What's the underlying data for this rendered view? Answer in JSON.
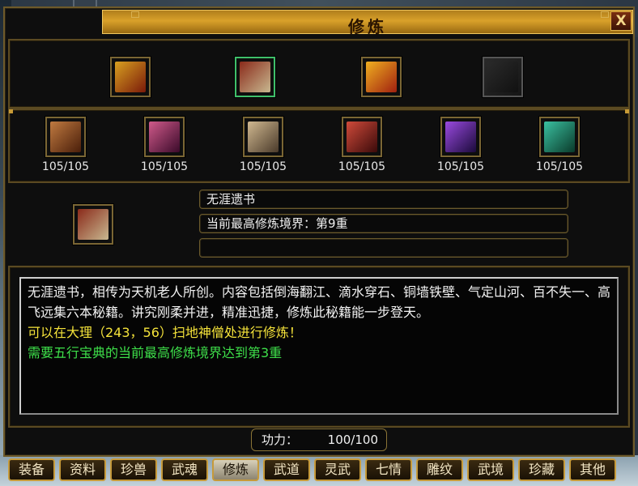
{
  "window": {
    "title": "修炼",
    "help_label": "?",
    "close_label": "X"
  },
  "top_items": [
    {
      "icon": "golden-books-icon",
      "selected": false,
      "empty": false,
      "c1": "#d8a020",
      "c2": "#7a1a0a"
    },
    {
      "icon": "scroll-bundle-icon",
      "selected": true,
      "empty": false,
      "c1": "#8a2a1a",
      "c2": "#c8b890"
    },
    {
      "icon": "gold-ingots-icon",
      "selected": false,
      "empty": false,
      "c1": "#f0b020",
      "c2": "#a02010"
    },
    {
      "icon": "empty-slot-icon",
      "selected": false,
      "empty": true,
      "c1": "#2a2a2a",
      "c2": "#111111"
    }
  ],
  "manuals": [
    {
      "icon": "manual-bronze-icon",
      "count": "105/105",
      "c1": "#c07a40",
      "c2": "#4a1e0a"
    },
    {
      "icon": "manual-pink-icon",
      "count": "105/105",
      "c1": "#d05a8a",
      "c2": "#3a0a2a"
    },
    {
      "icon": "manual-tan-icon",
      "count": "105/105",
      "c1": "#d0b890",
      "c2": "#4a3a2a"
    },
    {
      "icon": "manual-red-icon",
      "count": "105/105",
      "c1": "#d04a3a",
      "c2": "#3a0a0a"
    },
    {
      "icon": "manual-purple-icon",
      "count": "105/105",
      "c1": "#9a4ae0",
      "c2": "#1a0a3a"
    },
    {
      "icon": "manual-teal-icon",
      "count": "105/105",
      "c1": "#3ac0a0",
      "c2": "#0a3a2a"
    }
  ],
  "selected": {
    "icon": "scroll-bundle-icon",
    "name": "无涯遗书",
    "realm": "当前最高修炼境界：第9重",
    "extra": ""
  },
  "description": {
    "line_white": "无涯遗书，相传为天机老人所创。内容包括倒海翻江、滴水穿石、铜墙铁壁、气定山河、百不失一、高飞远集六本秘籍。讲究刚柔并进，精准迅捷，修炼此秘籍能一步登天。",
    "line_yellow": "可以在大理（243，56）扫地神僧处进行修炼！",
    "line_green": "需要五行宝典的当前最高修炼境界达到第3重"
  },
  "gongli": {
    "label": "功力：",
    "value": "100/100"
  },
  "tabs": [
    {
      "label": "装备",
      "active": false
    },
    {
      "label": "资料",
      "active": false
    },
    {
      "label": "珍兽",
      "active": false
    },
    {
      "label": "武魂",
      "active": false
    },
    {
      "label": "修炼",
      "active": true
    },
    {
      "label": "武道",
      "active": false
    },
    {
      "label": "灵武",
      "active": false
    },
    {
      "label": "七情",
      "active": false
    },
    {
      "label": "雕纹",
      "active": false
    },
    {
      "label": "武境",
      "active": false
    },
    {
      "label": "珍藏",
      "active": false
    },
    {
      "label": "其他",
      "active": false
    }
  ]
}
